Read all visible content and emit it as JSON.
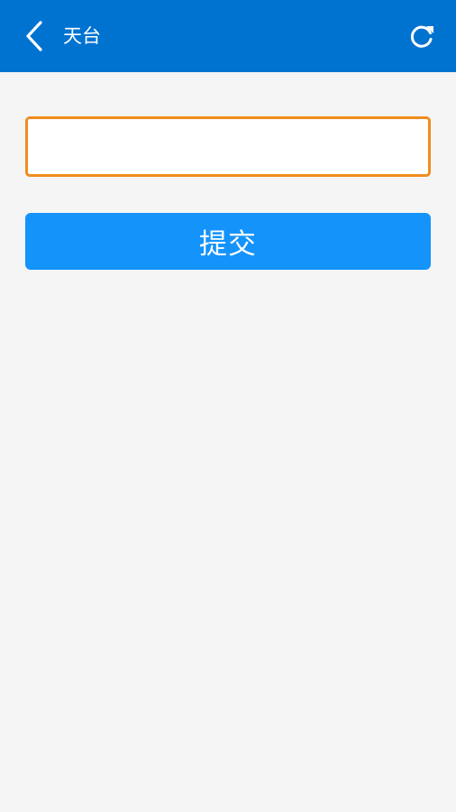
{
  "header": {
    "title": "天台",
    "back_icon": "chevron-left-icon",
    "refresh_icon": "refresh-icon",
    "background_color": "#0073d1"
  },
  "form": {
    "input_value": "",
    "input_placeholder": "",
    "input_border_color": "#f08c1e",
    "submit_label": "提交",
    "submit_color": "#1493fb"
  }
}
